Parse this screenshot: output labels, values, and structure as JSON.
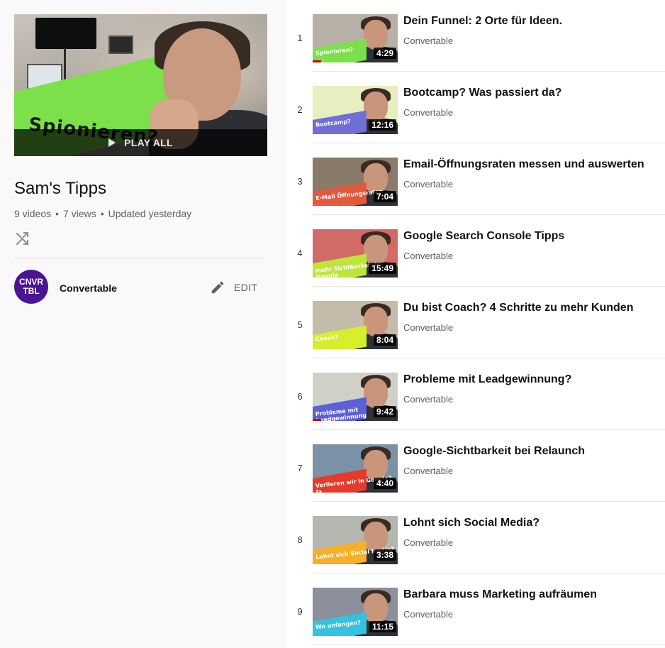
{
  "playlist": {
    "hero_overlay_word": "Spionieren?",
    "play_all_label": "PLAY ALL",
    "title": "Sam's Tipps",
    "video_count": "9 videos",
    "views": "7 views",
    "updated": "Updated yesterday",
    "separator": "•"
  },
  "owner": {
    "avatar_line1": "CNVR",
    "avatar_line2": "TBL",
    "name": "Convertable",
    "edit_label": "EDIT",
    "avatar_color": "#4a1590"
  },
  "videos": [
    {
      "index": "1",
      "title": "Dein Funnel: 2 Orte für Ideen.",
      "channel": "Convertable",
      "duration": "4:29",
      "tag": "Spionieren?",
      "banner_color": "#7be04a",
      "bg_color": "#b7b0a6",
      "watched_fraction": 0.1
    },
    {
      "index": "2",
      "title": "Bootcamp? Was passiert da?",
      "channel": "Convertable",
      "duration": "12:16",
      "tag": "Bootcamp?",
      "banner_color": "#6f6fd6",
      "bg_color": "#e7efc0",
      "watched_fraction": 0.0
    },
    {
      "index": "3",
      "title": "Email-Öffnungsraten messen und auswerten",
      "channel": "Convertable",
      "duration": "7:04",
      "tag": "E-Mail Öffnungsraten",
      "banner_color": "#e2593b",
      "bg_color": "#8a7a6a",
      "watched_fraction": 0.0
    },
    {
      "index": "4",
      "title": "Google Search Console Tipps",
      "channel": "Convertable",
      "duration": "15:49",
      "tag": "mehr Sichtbarkeit in Google",
      "banner_color": "#bde63a",
      "bg_color": "#d26a68",
      "watched_fraction": 0.0
    },
    {
      "index": "5",
      "title": "Du bist Coach? 4 Schritte zu mehr Kunden",
      "channel": "Convertable",
      "duration": "8:04",
      "tag": "Coach?",
      "banner_color": "#d6ef2b",
      "bg_color": "#c4bba8",
      "watched_fraction": 0.0
    },
    {
      "index": "6",
      "title": "Probleme mit Leadgewinnung?",
      "channel": "Convertable",
      "duration": "9:42",
      "tag": "Probleme mit Leadgewinnung",
      "banner_color": "#5c5fd6",
      "bg_color": "#cfd0c8",
      "watched_fraction": 0.1
    },
    {
      "index": "7",
      "title": "Google-Sichtbarkeit bei Relaunch",
      "channel": "Convertable",
      "duration": "4:40",
      "tag": "Verlieren wir in Google? Ja",
      "banner_color": "#e53a2c",
      "bg_color": "#7b92a6",
      "watched_fraction": 0.0
    },
    {
      "index": "8",
      "title": "Lohnt sich Social Media?",
      "channel": "Convertable",
      "duration": "3:38",
      "tag": "Lohnt sich Social Media?",
      "banner_color": "#f4b02a",
      "bg_color": "#b4b7b0",
      "watched_fraction": 0.0
    },
    {
      "index": "9",
      "title": "Barbara muss Marketing aufräumen",
      "channel": "Convertable",
      "duration": "11:15",
      "tag": "Wo anfangen?",
      "banner_color": "#33c3e0",
      "bg_color": "#8c8f9c",
      "watched_fraction": 0.0
    }
  ]
}
